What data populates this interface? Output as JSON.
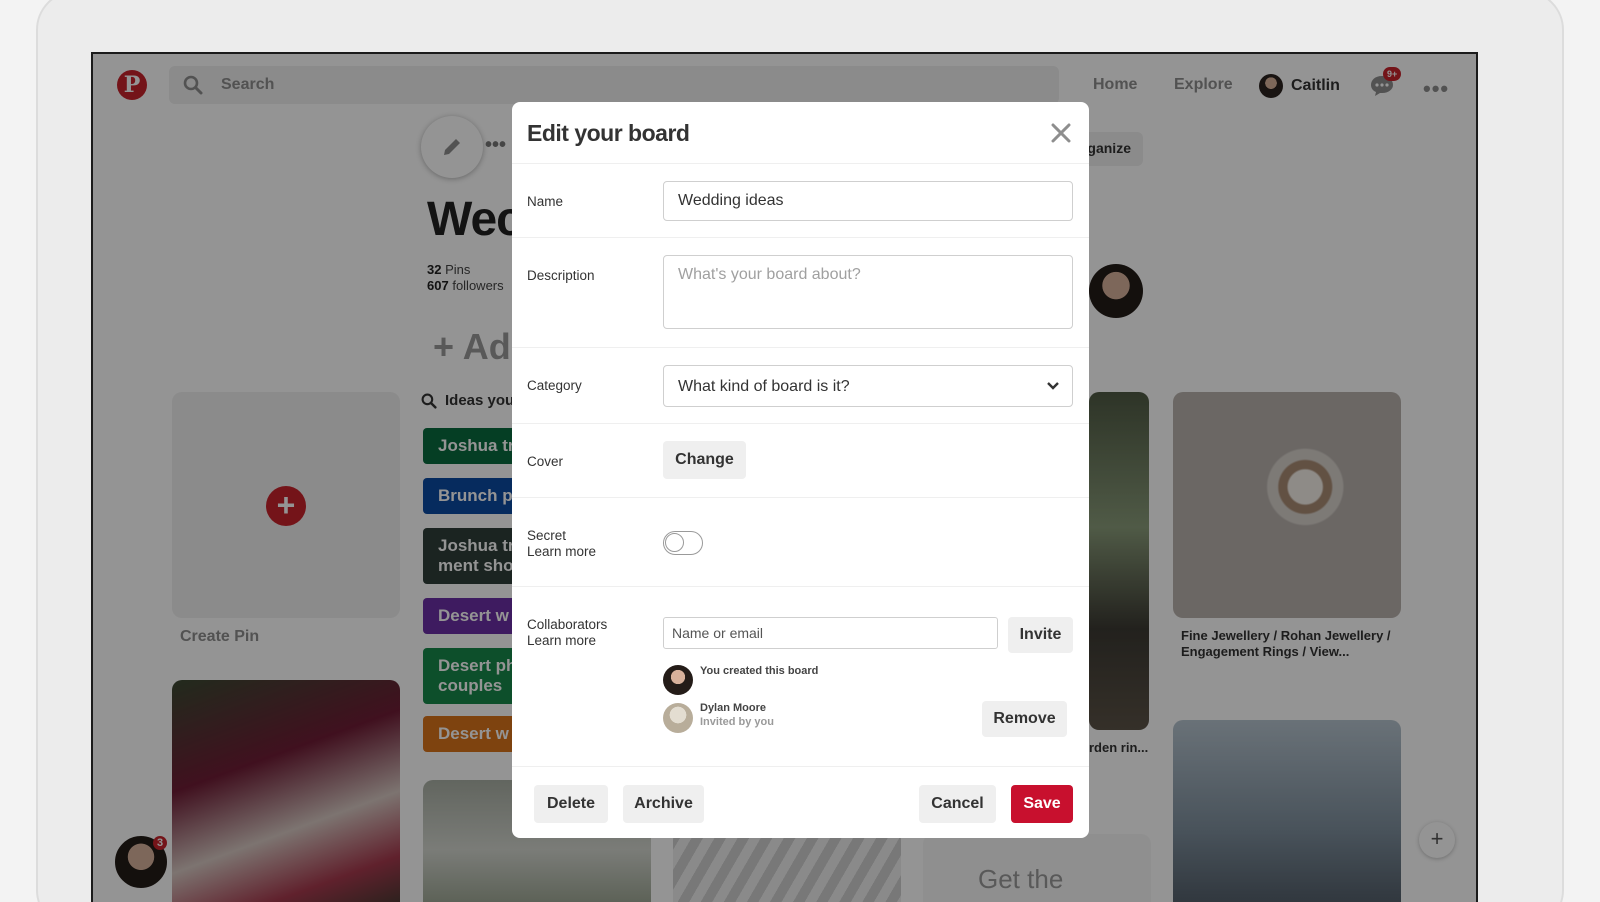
{
  "nav": {
    "logo": "P",
    "search_placeholder": "Search",
    "home": "Home",
    "explore": "Explore",
    "user_name": "Caitlin",
    "notification_count": "9+"
  },
  "board": {
    "title": "Wec",
    "pins_count": "32",
    "pins_label": "Pins",
    "followers_count": "607",
    "followers_label": "followers",
    "add_text": "+ Ad",
    "ideas_text": "Ideas you",
    "organize_text": "ganize",
    "create_pin": "Create Pin",
    "idea_tags": [
      {
        "text": "Joshua tr",
        "color": "#0a6b3f"
      },
      {
        "text": "Brunch p",
        "color": "#0b4aa2"
      },
      {
        "text": "Joshua tr ment sho",
        "color": "#2f3e3a"
      },
      {
        "text": "Desert w",
        "color": "#6b2fa5"
      },
      {
        "text": "Desert ph couples",
        "color": "#18894b"
      },
      {
        "text": "Desert w",
        "color": "#d9741b"
      }
    ],
    "ring_caption": "Fine Jewellery / Rohan Jewellery / Engagement Rings / View...",
    "hall_caption": "rden rin...",
    "get_the_text": "Get the",
    "profile_badge": "3"
  },
  "modal": {
    "title": "Edit your board",
    "name_label": "Name",
    "name_value": "Wedding ideas",
    "description_label": "Description",
    "description_placeholder": "What's your board about?",
    "category_label": "Category",
    "category_value": "What kind of board is it?",
    "cover_label": "Cover",
    "change_button": "Change",
    "secret_label": "Secret",
    "secret_learn_more": "Learn more",
    "collaborators_label": "Collaborators",
    "collaborators_learn_more": "Learn more",
    "collab_placeholder": "Name or email",
    "invite_button": "Invite",
    "you_created": "You created this board",
    "dylan_name": "Dylan Moore",
    "dylan_sub": "Invited by you",
    "remove_button": "Remove",
    "delete_button": "Delete",
    "archive_button": "Archive",
    "cancel_button": "Cancel",
    "save_button": "Save"
  },
  "colors": {
    "brand_red": "#c8232c",
    "save_red": "#c8102e"
  }
}
